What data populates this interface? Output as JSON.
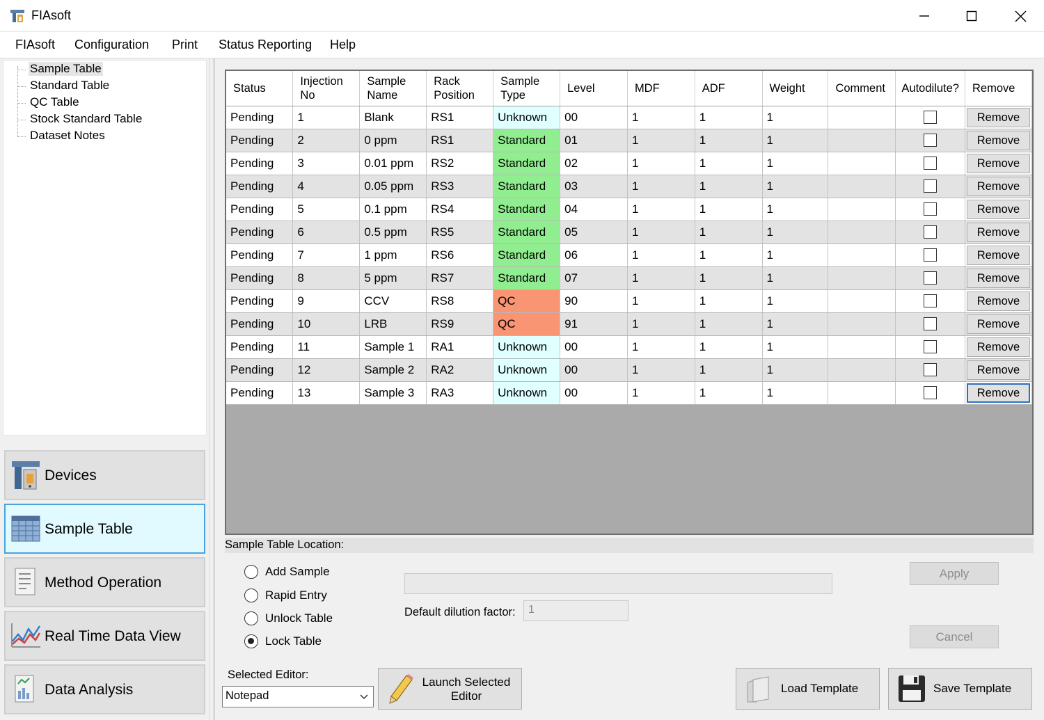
{
  "window": {
    "title": "FIAsoft"
  },
  "menu": [
    "FIAsoft",
    "Configuration",
    "Print",
    "Status Reporting",
    "Help"
  ],
  "tree": {
    "items": [
      "Sample Table",
      "Standard Table",
      "QC Table",
      "Stock Standard Table",
      "Dataset Notes"
    ],
    "selected": "Sample Table"
  },
  "nav": {
    "buttons": [
      {
        "label": "Devices",
        "icon": "devices-icon"
      },
      {
        "label": "Sample Table",
        "icon": "table-icon",
        "active": true
      },
      {
        "label": "Method Operation",
        "icon": "method-icon"
      },
      {
        "label": "Real Time Data View",
        "icon": "chart-line-icon"
      },
      {
        "label": "Data Analysis",
        "icon": "data-analysis-icon"
      }
    ]
  },
  "grid": {
    "columns": [
      "Status",
      "Injection No",
      "Sample Name",
      "Rack Position",
      "Sample Type",
      "Level",
      "MDF",
      "ADF",
      "Weight",
      "Comment",
      "Autodilute?",
      "Remove"
    ],
    "remove_label": "Remove",
    "rows": [
      {
        "status": "Pending",
        "inj": "1",
        "name": "Blank",
        "rack": "RS1",
        "type": "Unknown",
        "level": "00",
        "mdf": "1",
        "adf": "1",
        "weight": "1",
        "comment": ""
      },
      {
        "status": "Pending",
        "inj": "2",
        "name": "0 ppm",
        "rack": "RS1",
        "type": "Standard",
        "level": "01",
        "mdf": "1",
        "adf": "1",
        "weight": "1",
        "comment": ""
      },
      {
        "status": "Pending",
        "inj": "3",
        "name": "0.01 ppm",
        "rack": "RS2",
        "type": "Standard",
        "level": "02",
        "mdf": "1",
        "adf": "1",
        "weight": "1",
        "comment": ""
      },
      {
        "status": "Pending",
        "inj": "4",
        "name": "0.05 ppm",
        "rack": "RS3",
        "type": "Standard",
        "level": "03",
        "mdf": "1",
        "adf": "1",
        "weight": "1",
        "comment": ""
      },
      {
        "status": "Pending",
        "inj": "5",
        "name": "0.1 ppm",
        "rack": "RS4",
        "type": "Standard",
        "level": "04",
        "mdf": "1",
        "adf": "1",
        "weight": "1",
        "comment": ""
      },
      {
        "status": "Pending",
        "inj": "6",
        "name": "0.5 ppm",
        "rack": "RS5",
        "type": "Standard",
        "level": "05",
        "mdf": "1",
        "adf": "1",
        "weight": "1",
        "comment": ""
      },
      {
        "status": "Pending",
        "inj": "7",
        "name": "1 ppm",
        "rack": "RS6",
        "type": "Standard",
        "level": "06",
        "mdf": "1",
        "adf": "1",
        "weight": "1",
        "comment": ""
      },
      {
        "status": "Pending",
        "inj": "8",
        "name": "5 ppm",
        "rack": "RS7",
        "type": "Standard",
        "level": "07",
        "mdf": "1",
        "adf": "1",
        "weight": "1",
        "comment": ""
      },
      {
        "status": "Pending",
        "inj": "9",
        "name": "CCV",
        "rack": "RS8",
        "type": "QC",
        "level": "90",
        "mdf": "1",
        "adf": "1",
        "weight": "1",
        "comment": ""
      },
      {
        "status": "Pending",
        "inj": "10",
        "name": "LRB",
        "rack": "RS9",
        "type": "QC",
        "level": "91",
        "mdf": "1",
        "adf": "1",
        "weight": "1",
        "comment": ""
      },
      {
        "status": "Pending",
        "inj": "11",
        "name": "Sample 1",
        "rack": "RA1",
        "type": "Unknown",
        "level": "00",
        "mdf": "1",
        "adf": "1",
        "weight": "1",
        "comment": ""
      },
      {
        "status": "Pending",
        "inj": "12",
        "name": "Sample 2",
        "rack": "RA2",
        "type": "Unknown",
        "level": "00",
        "mdf": "1",
        "adf": "1",
        "weight": "1",
        "comment": ""
      },
      {
        "status": "Pending",
        "inj": "13",
        "name": "Sample 3",
        "rack": "RA3",
        "type": "Unknown",
        "level": "00",
        "mdf": "1",
        "adf": "1",
        "weight": "1",
        "comment": ""
      }
    ],
    "type_colors": {
      "Unknown": "#e0ffff",
      "Standard": "#90ee90",
      "QC": "#fa9573"
    }
  },
  "location": {
    "label": "Sample Table Location:"
  },
  "modes": {
    "options": [
      "Add Sample",
      "Rapid Entry",
      "Unlock Table",
      "Lock Table"
    ],
    "selected": "Lock Table"
  },
  "dilution": {
    "label": "Default dilution factor:",
    "value": "1"
  },
  "actions": {
    "apply": "Apply",
    "cancel": "Cancel",
    "load_template": "Load Template",
    "save_template": "Save Template",
    "launch_editor": "Launch Selected Editor"
  },
  "editor": {
    "label": "Selected Editor:",
    "value": "Notepad"
  }
}
